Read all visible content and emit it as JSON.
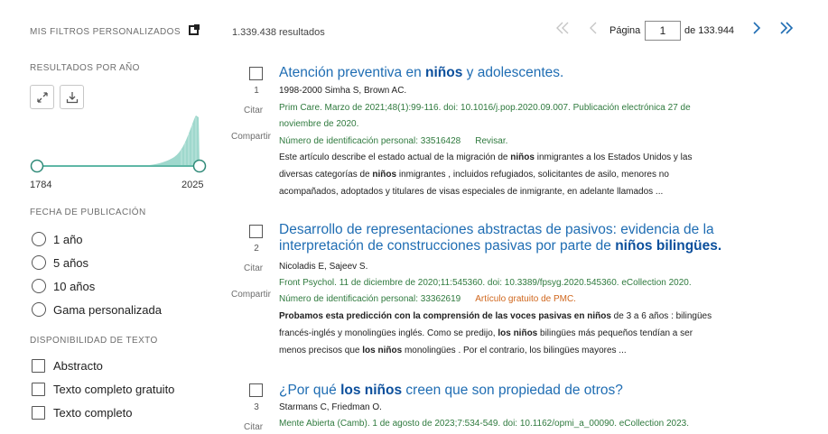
{
  "sidebar": {
    "my_filters": "MIS FILTROS PERSONALIZADOS",
    "results_by_year": "RESULTADOS POR AÑO",
    "year_start": "1784",
    "year_end": "2025",
    "expand_icon": "expand-icon",
    "download_icon": "download-icon",
    "pub_date_title": "FECHA DE PUBLICACIÓN",
    "pub_date_options": [
      "1 año",
      "5 años",
      "10 años",
      "Gama personalizada"
    ],
    "text_avail_title": "DISPONIBILIDAD DE TEXTO",
    "text_avail_options": [
      "Abstracto",
      "Texto completo gratuito",
      "Texto completo"
    ]
  },
  "results": {
    "count": "1.339.438 resultados",
    "page_label": "Página",
    "page_value": "1",
    "page_total": "de 133.944"
  },
  "colors": {
    "link": "#1f6db3",
    "citation_green": "#2f7a3e",
    "free_orange": "#d0661c",
    "histogram": "#8ed1c4"
  },
  "items": [
    {
      "num": "1",
      "cite": "Citar",
      "share": "Compartir",
      "title_a": "Atención preventiva en ",
      "title_b": "niños",
      "title_c": " y adolescentes.",
      "authors": "1998-2000 Simha S, Brown AC.",
      "citation_1": "Prim Care. Marzo de 2021;48(1):99-116. doi: 10.1016/j.pop.2020.09.007. Publicación electrónica 27 de",
      "citation_2": "noviembre de 2020.",
      "pmid": "Número de identificación personal: 33516428",
      "tag": "Revisar.",
      "s1a": "Este artículo describe el estado actual de la migración de ",
      "s1b": "niños",
      "s1c": " inmigrantes a los Estados Unidos y las",
      "s2a": "diversas categorías de ",
      "s2b": "niños",
      "s2c": " inmigrantes , incluidos refugiados, solicitantes de asilo, menores no",
      "s3": "acompañados, adoptados y titulares de visas especiales de inmigrante, en adelante llamados ..."
    },
    {
      "num": "2",
      "cite": "Citar",
      "share": "Compartir",
      "title_line1": "Desarrollo de representaciones abstractas de pasivos: evidencia de la",
      "title_line2a": "interpretación de construcciones pasivas por parte de ",
      "title_line2b": "niños bilingües.",
      "authors": "Nicoladis E, Sajeev S.",
      "citation_1": "Front Psychol. 11 de diciembre de 2020;11:545360. doi: 10.3389/fpsyg.2020.545360. eCollection 2020.",
      "pmid": "Número de identificación personal: 33362619",
      "tag": "Artículo gratuito de PMC.",
      "s1a": "Probamos esta predicción con la comprensión de las voces pasivas en niños",
      "s1c": " de 3 a 6 años : bilingües",
      "s2a": "francés-inglés y monolingües inglés. Como se predijo, ",
      "s2b": "los niños",
      "s2c": " bilingües más pequeños tendían a ser",
      "s3a": "menos precisos que ",
      "s3b": "los niños",
      "s3c": " monolingües . Por el contrario, los bilingües mayores ..."
    },
    {
      "num": "3",
      "cite": "Citar",
      "title_a": "¿Por qué ",
      "title_b": "los niños",
      "title_c": " creen que son propiedad de otros?",
      "authors": "Starmans C, Friedman O.",
      "citation_1": "Mente Abierta (Camb). 1 de agosto de 2023;7:534-549. doi: 10.1162/opmi_a_00090. eCollection 2023."
    }
  ]
}
